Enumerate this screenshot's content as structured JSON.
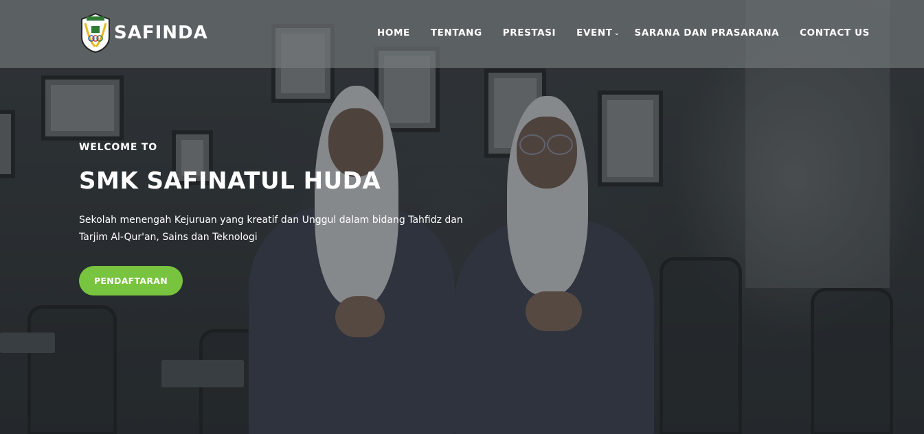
{
  "brand": {
    "name": "SAFINDA"
  },
  "nav": {
    "items": [
      {
        "label": "HOME"
      },
      {
        "label": "TENTANG"
      },
      {
        "label": "PRESTASI"
      },
      {
        "label": "EVENT",
        "icon": "chevron-down-icon"
      },
      {
        "label": "SARANA DAN PRASARANA"
      },
      {
        "label": "CONTACT US"
      }
    ]
  },
  "hero": {
    "welcome": "WELCOME TO",
    "title": "SMK SAFINATUL HUDA",
    "description": "Sekolah menengah Kejuruan yang kreatif dan Unggul dalam bidang Tahfidz dan Tarjim Al-Qur'an, Sains dan Teknologi",
    "cta_label": "PENDAFTARAN"
  },
  "colors": {
    "accent": "#78c43f",
    "header_bg": "#7c7f81",
    "text": "#ffffff"
  }
}
